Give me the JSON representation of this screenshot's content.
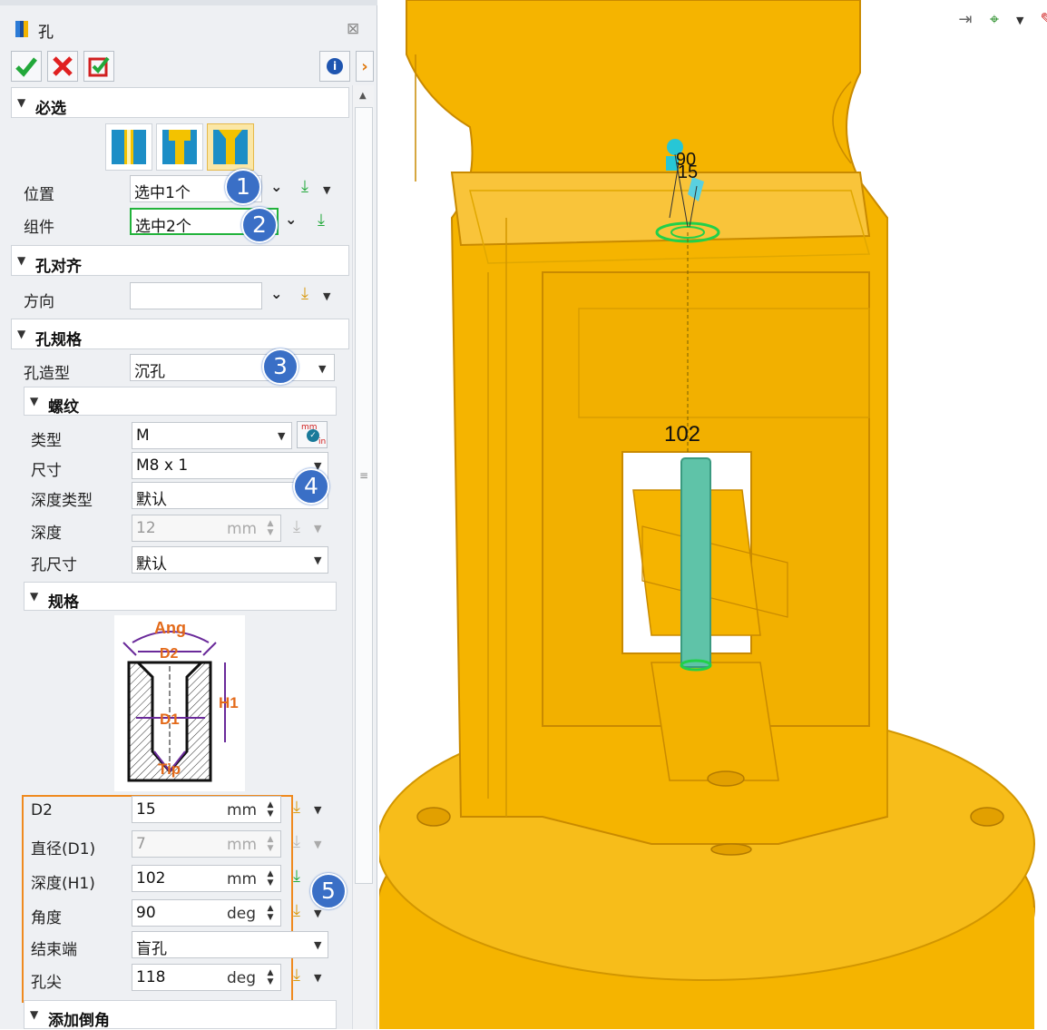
{
  "dialog": {
    "title": "孔"
  },
  "sections": {
    "required": "必选",
    "align": "孔对齐",
    "spec": "孔规格",
    "thread": "螺纹",
    "dims": "规格",
    "chamfer": "添加倒角"
  },
  "fields": {
    "position": {
      "label": "位置",
      "value": "选中1个"
    },
    "component": {
      "label": "组件",
      "value": "选中2个"
    },
    "direction": {
      "label": "方向",
      "value": ""
    },
    "hole_shape": {
      "label": "孔造型",
      "value": "沉孔"
    },
    "thread_type": {
      "label": "类型",
      "value": "M"
    },
    "size": {
      "label": "尺寸",
      "value": "M8 x 1"
    },
    "depth_type": {
      "label": "深度类型",
      "value": "默认"
    },
    "depth": {
      "label": "深度",
      "value": "12",
      "unit": "mm"
    },
    "hole_size": {
      "label": "孔尺寸",
      "value": "默认"
    },
    "d2": {
      "label": "D2",
      "value": "15",
      "unit": "mm"
    },
    "d1": {
      "label": "直径(D1)",
      "value": "7",
      "unit": "mm"
    },
    "h1": {
      "label": "深度(H1)",
      "value": "102",
      "unit": "mm"
    },
    "angle": {
      "label": "角度",
      "value": "90",
      "unit": "deg"
    },
    "end": {
      "label": "结束端",
      "value": "盲孔"
    },
    "tip": {
      "label": "孔尖",
      "value": "118",
      "unit": "deg"
    }
  },
  "diagram": {
    "ang": "Ang",
    "d2": "D2",
    "h1": "H1",
    "d1": "D1",
    "tip": "Tip"
  },
  "badges": [
    "1",
    "2",
    "3",
    "4",
    "5"
  ],
  "viewport": {
    "dim_102": "102",
    "dim_90": "90",
    "dim_15": "15"
  },
  "thread_unit_icon": {
    "top": "mm",
    "bottom": "in"
  },
  "colors": {
    "part": "#f5b400",
    "part_edge": "#c98a00",
    "hole": "#5fc3a8",
    "accent": "#3a6fc6",
    "highlight_box": "#ef8a1f",
    "selected_border": "#22b33b"
  }
}
